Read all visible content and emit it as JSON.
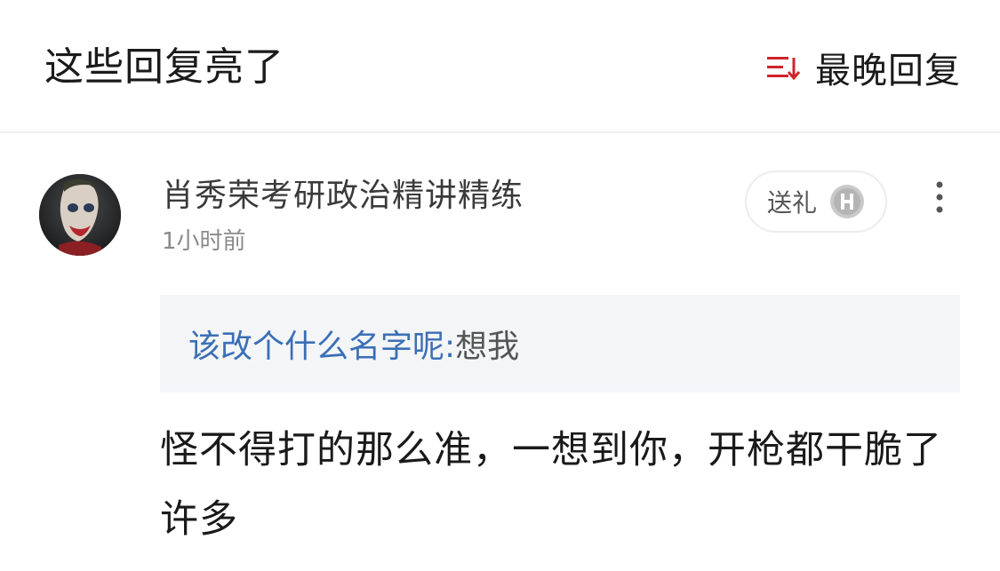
{
  "header": {
    "title": "这些回复亮了",
    "sort_label": "最晚回复",
    "sort_icon": "sort-descending-icon",
    "sort_icon_color": "#d1232a"
  },
  "comment": {
    "username": "肖秀荣考研政治精讲精练",
    "timestamp": "1小时前",
    "gift_label": "送礼",
    "gift_icon": "hupu-h-coin-icon",
    "more_icon": "more-vertical-icon",
    "quote": {
      "author": "该改个什么名字呢:",
      "text": " 想我"
    },
    "text": "怪不得打的那么准，一想到你，开枪都干脆了许多"
  },
  "colors": {
    "quote_author": "#3b6fb5",
    "quote_background": "#f4f5f7",
    "accent_red": "#d1232a"
  }
}
